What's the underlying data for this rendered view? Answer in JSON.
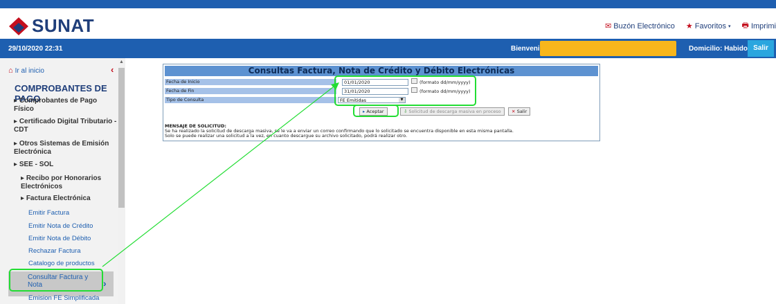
{
  "brand": {
    "name": "SUNAT"
  },
  "toplinks": {
    "buzon": "Buzón Electrónico",
    "favoritos": "Favoritos",
    "imprimir": "Imprimi"
  },
  "bluebar": {
    "datetime": "29/10/2020 22:31",
    "welcome": "Bienvenido,",
    "domicilio": "Domicilio: Habido",
    "salir": "Salir"
  },
  "sidebar": {
    "home": "Ir al inicio",
    "title": "COMPROBANTES DE PAGO",
    "items": [
      "Comprobantes de Pago Físico",
      "Certificado Digital Tributario - CDT",
      "Otros Sistemas de Emisión Electrónica",
      "SEE - SOL",
      "Recibo por Honorarios Electrónicos",
      "Factura Electrónica"
    ],
    "links": [
      "Emitir Factura",
      "Emitir Nota de Crédito",
      "Emitir Nota de Débito",
      "Rechazar Factura",
      "Catalogo de productos",
      "Consultar Factura y Nota",
      "Emision FE Simplificada"
    ]
  },
  "form": {
    "title": "Consultas Factura, Nota de Crédito y Débito Electrónicas",
    "fecha_inicio_label": "Fecha de Inicio",
    "fecha_inicio_value": "01/01/2020",
    "fecha_fin_label": "Fecha de Fin",
    "fecha_fin_value": "31/01/2020",
    "format_hint": "(formato dd/mm/yyyy)",
    "tipo_label": "Tipo de Consulta",
    "tipo_value": "FE Emitidas",
    "btn_aceptar": "Aceptar",
    "btn_solicitud": "Solicitud de descarga masiva en proceso",
    "btn_salir": "Salir",
    "msg_title": "MENSAJE DE SOLICITUD:",
    "msg_line1": "Se ha realizado la solicitud de descarga masiva, se le va a enviar un correo confirmando que lo solicitado se encuentra disponible en esta misma pantalla.",
    "msg_line2": "Solo se puede realizar una solicitud a la vez, en cuanto descargue su archivo solicitado, podrá realizar otro."
  },
  "colors": {
    "header_blue": "#1e5fb0",
    "title_blue": "#5d92d1",
    "row_blue": "#a5c1e8",
    "brand_red": "#c40f1e",
    "highlight_green": "#22dd33",
    "welcome_box": "#f7b61c"
  }
}
